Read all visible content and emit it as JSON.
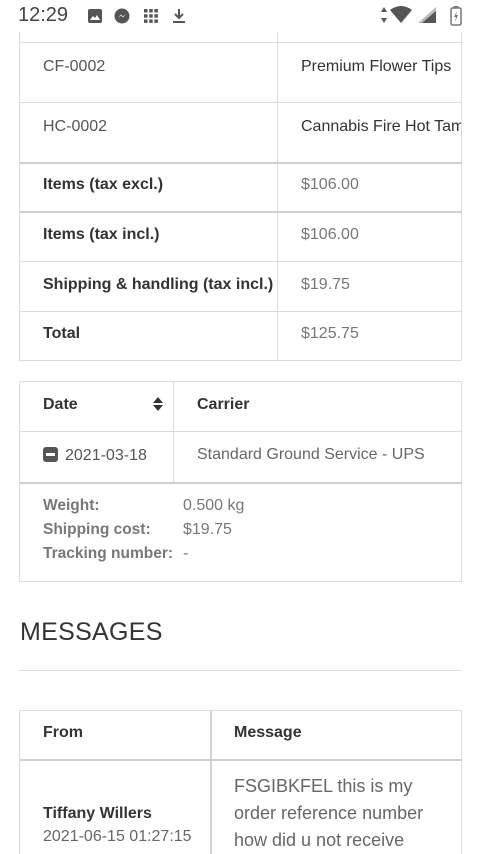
{
  "status_bar": {
    "time": "12:29"
  },
  "order_table": {
    "rows": [
      {
        "ref": "CF-0002",
        "name": "Premium Flower Tips"
      },
      {
        "ref": "HC-0002",
        "name": "Cannabis Fire Hot Tam"
      }
    ],
    "totals": [
      {
        "label": "Items (tax excl.)",
        "value": "$106.00"
      },
      {
        "label": "Items (tax incl.)",
        "value": "$106.00"
      },
      {
        "label": "Shipping & handling (tax incl.)",
        "value": "$19.75"
      },
      {
        "label": "Total",
        "value": "$125.75"
      }
    ]
  },
  "shipping_table": {
    "headers": {
      "date": "Date",
      "carrier": "Carrier"
    },
    "row": {
      "date": "2021-03-18",
      "carrier": "Standard Ground Service - UPS"
    },
    "details": {
      "weight_label": "Weight:",
      "weight_value": "0.500 kg",
      "cost_label": "Shipping cost:",
      "cost_value": "$19.75",
      "tracking_label": "Tracking number:",
      "tracking_value": "-"
    }
  },
  "messages": {
    "heading": "MESSAGES",
    "headers": {
      "from": "From",
      "message": "Message"
    },
    "row": {
      "author": "Tiffany Willers",
      "datetime": "2021-06-15 01:27:15",
      "message_lines": [
        "FSGIBKFEL this is my",
        "order reference number",
        "how did u not receive"
      ]
    }
  }
}
